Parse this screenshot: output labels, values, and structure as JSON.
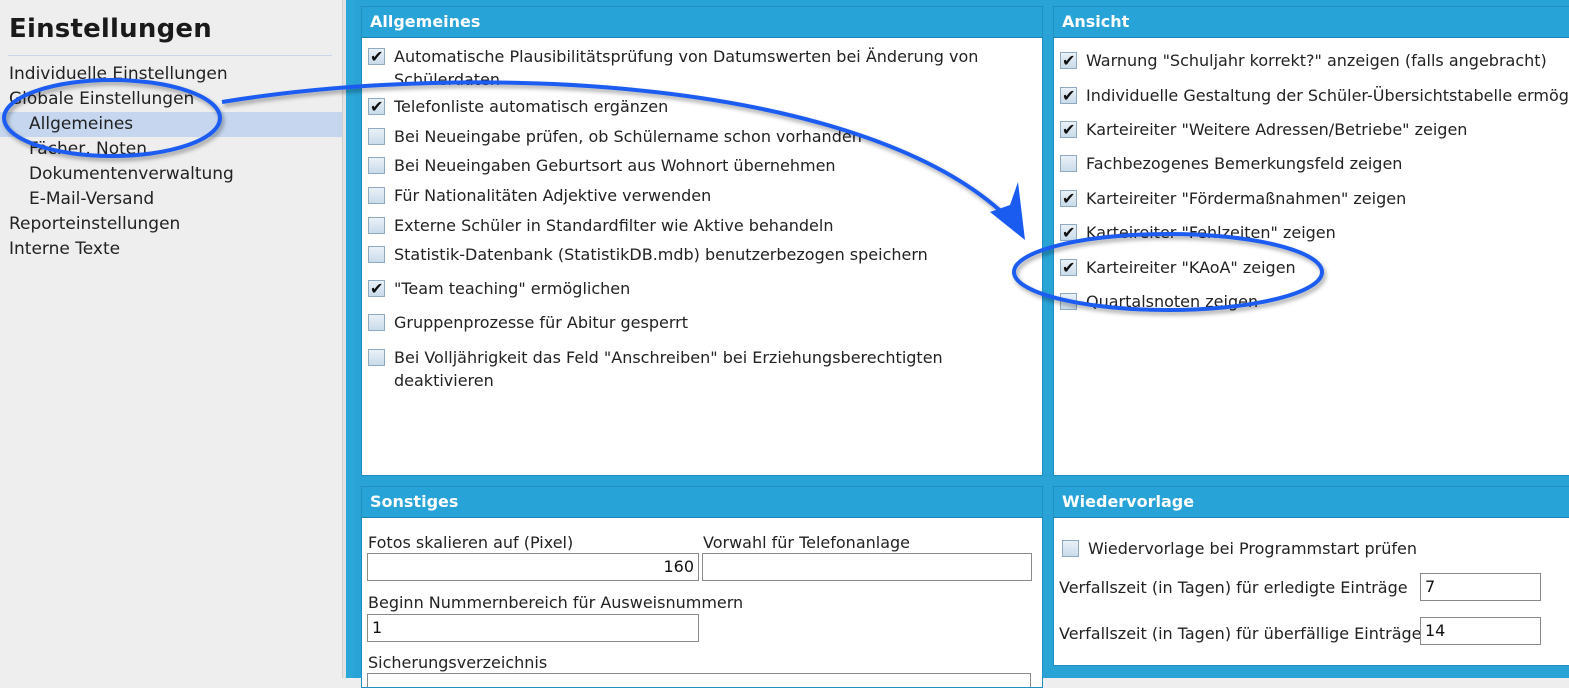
{
  "sidebar": {
    "title": "Einstellungen",
    "items": [
      {
        "label": "Individuelle Einstellungen",
        "level": 1,
        "selected": false
      },
      {
        "label": "Globale Einstellungen",
        "level": 1,
        "selected": false
      },
      {
        "label": "Allgemeines",
        "level": 2,
        "selected": true
      },
      {
        "label": "Fächer, Noten",
        "level": 2,
        "selected": false
      },
      {
        "label": "Dokumentenverwaltung",
        "level": 2,
        "selected": false
      },
      {
        "label": "E-Mail-Versand",
        "level": 2,
        "selected": false
      },
      {
        "label": "Reporteinstellungen",
        "level": 1,
        "selected": false
      },
      {
        "label": "Interne Texte",
        "level": 1,
        "selected": false
      }
    ]
  },
  "allgemeines": {
    "title": "Allgemeines",
    "options": [
      {
        "label": "Automatische Plausibilitätsprüfung von Datumswerten bei Änderung von Schülerdaten",
        "checked": true
      },
      {
        "label": "Telefonliste automatisch ergänzen",
        "checked": true
      },
      {
        "label": "Bei Neueingabe prüfen, ob Schülername schon vorhanden",
        "checked": false
      },
      {
        "label": "Bei Neueingaben Geburtsort aus Wohnort übernehmen",
        "checked": false
      },
      {
        "label": "Für Nationalitäten Adjektive verwenden",
        "checked": false
      },
      {
        "label": "Externe Schüler in Standardfilter wie Aktive behandeln",
        "checked": false
      },
      {
        "label": "Statistik-Datenbank (StatistikDB.mdb) benutzerbezogen speichern",
        "checked": false
      },
      {
        "label": "\"Team teaching\" ermöglichen",
        "checked": true
      },
      {
        "label": "Gruppenprozesse für Abitur gesperrt",
        "checked": false
      },
      {
        "label": "Bei Volljährigkeit das Feld \"Anschreiben\" bei Erziehungsberechtigten deaktivieren",
        "checked": false
      }
    ]
  },
  "ansicht": {
    "title": "Ansicht",
    "options": [
      {
        "label": "Warnung \"Schuljahr korrekt?\" anzeigen (falls angebracht)",
        "checked": true
      },
      {
        "label": "Individuelle Gestaltung der Schüler-Übersichtstabelle ermöglicl",
        "checked": true
      },
      {
        "label": "Karteireiter \"Weitere Adressen/Betriebe\" zeigen",
        "checked": true
      },
      {
        "label": "Fachbezogenes Bemerkungsfeld zeigen",
        "checked": false
      },
      {
        "label": "Karteireiter \"Fördermaßnahmen\" zeigen",
        "checked": true
      },
      {
        "label": "Karteireiter \"Fehlzeiten\" zeigen",
        "checked": true
      },
      {
        "label": "Karteireiter \"KAoA\" zeigen",
        "checked": true
      },
      {
        "label": "Quartalsnoten zeigen",
        "checked": false
      }
    ]
  },
  "sonstiges": {
    "title": "Sonstiges",
    "fotos_label": "Fotos skalieren auf (Pixel)",
    "fotos_value": "160",
    "vorwahl_label": "Vorwahl für Telefonanlage",
    "vorwahl_value": "",
    "ausweis_label": "Beginn Nummernbereich für Ausweisnummern",
    "ausweis_value": "1",
    "sicherung_label": "Sicherungsverzeichnis"
  },
  "wiedervorlage": {
    "title": "Wiedervorlage",
    "check_label": "Wiedervorlage bei Programmstart prüfen",
    "checked": false,
    "erledigt_label": "Verfallszeit (in Tagen) für erledigte Einträge",
    "erledigt_value": "7",
    "ueberfaellig_label": "Verfallszeit (in Tagen) für überfällige Einträge",
    "ueberfaellig_value": "14"
  },
  "colors": {
    "accent": "#27a3d8",
    "annotation": "#1a5cf0",
    "selection": "#c5d6ee"
  }
}
